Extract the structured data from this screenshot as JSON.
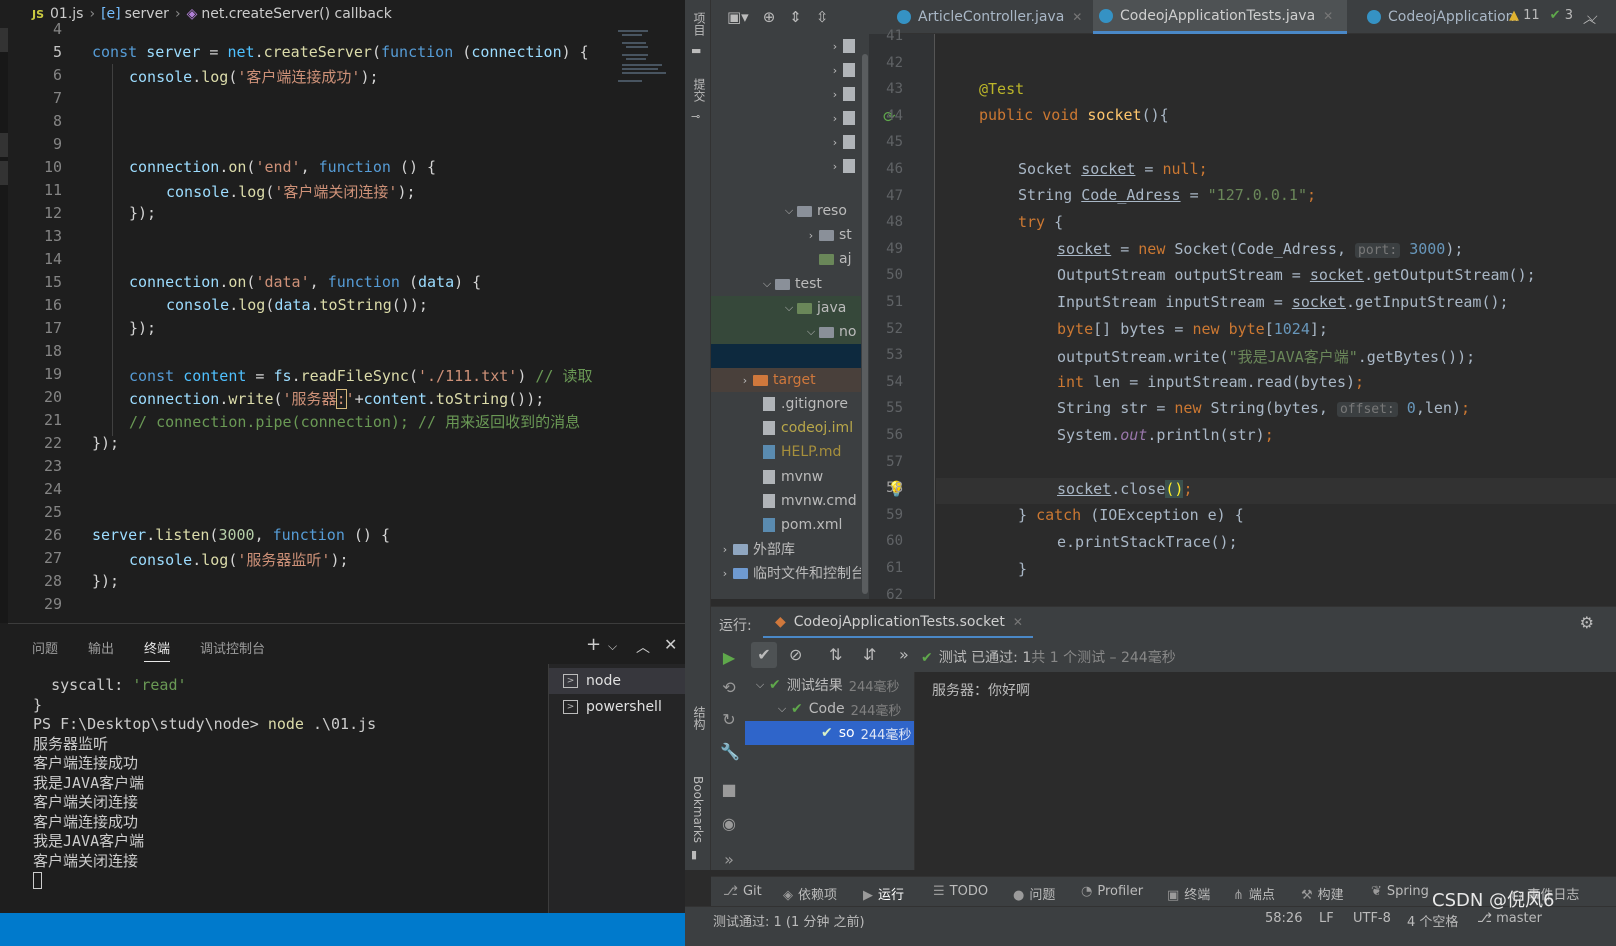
{
  "vscode": {
    "breadcrumb": {
      "lang_badge": "JS",
      "file": "01.js",
      "symbol1": "server",
      "symbol2": "net.createServer() callback"
    },
    "line_numbers": [
      "4",
      "5",
      "6",
      "7",
      "8",
      "9",
      "10",
      "11",
      "12",
      "13",
      "14",
      "15",
      "16",
      "17",
      "18",
      "19",
      "20",
      "21",
      "22",
      "23",
      "24",
      "25",
      "26",
      "27",
      "28",
      "29"
    ],
    "code": {
      "l5": {
        "kw": "const",
        "var": "server",
        "eq": " = ",
        "obj": "net",
        "dot": ".",
        "fn": "createServer",
        "p1": "(",
        "kw2": "function",
        "sp": " (",
        "arg": "connection",
        "rest": ") {"
      },
      "l6": {
        "obj": "console",
        "fn": "log",
        "str": "'客户端连接成功'",
        "end": ");"
      },
      "l10": {
        "obj": "connection",
        "fn": "on",
        "str": "'end'",
        "kw": "function",
        "rest": " () {"
      },
      "l11": {
        "obj": "console",
        "fn": "log",
        "str": "'客户端关闭连接'",
        "end": ");"
      },
      "l12": "});",
      "l15": {
        "obj": "connection",
        "fn": "on",
        "str": "'data'",
        "kw": "function",
        "arg": "data",
        "rest": ") {"
      },
      "l16": {
        "obj": "console",
        "fn": "log",
        "arg": "data",
        "fn2": "toString",
        "end": "());"
      },
      "l17": "});",
      "l19": {
        "kw": "const",
        "var": "content",
        "obj": "fs",
        "fn": "readFileSync",
        "str": "'./111.txt'",
        "cm": "// 读取"
      },
      "l20": {
        "obj": "connection",
        "fn": "write",
        "str_a": "'服务器",
        "str_box": ":",
        "str_b": "'",
        "plus": "+",
        "var": "content",
        "fn2": "toString",
        "end": "());"
      },
      "l21": {
        "cm": "// connection.pipe(connection); // 用来返回收到的消息"
      },
      "l22": "});",
      "l26": {
        "obj": "server",
        "fn": "listen",
        "num": "3000",
        "kw": "function",
        "rest": " () {"
      },
      "l27": {
        "obj": "console",
        "fn": "log",
        "str": "'服务器监听'",
        "end": ");"
      },
      "l28": "});"
    },
    "panel": {
      "tabs": [
        "问题",
        "输出",
        "终端",
        "调试控制台"
      ],
      "active_tab": "终端",
      "terminal": {
        "syscall_key": "syscall: ",
        "syscall_val": "'read'",
        "close_brace": "}",
        "prompt": "PS F:\\Desktop\\study\\node> ",
        "command": "node",
        "command_arg": " .\\01.js",
        "output": [
          "服务器监听",
          "客户端连接成功",
          "我是JAVA客户端",
          "客户端关闭连接",
          "客户端连接成功",
          "我是JAVA客户端",
          "客户端关闭连接"
        ]
      },
      "terminal_list": [
        "node",
        "powershell"
      ]
    }
  },
  "idea": {
    "side_labels": {
      "project": "项目",
      "commit": "提交",
      "structure": "结构",
      "bookmarks": "Bookmarks"
    },
    "tabs": [
      {
        "label": "ArticleController.java"
      },
      {
        "label": "CodeojApplicationTests.java"
      },
      {
        "label": "CodeojApplication."
      }
    ],
    "inspections": {
      "warnings": "11",
      "checks": "3"
    },
    "tree": [
      {
        "label": "reso"
      },
      {
        "label": "st"
      },
      {
        "label": "aj"
      },
      {
        "label": "test"
      },
      {
        "label": "java"
      },
      {
        "label": "no"
      },
      {
        "label": "target"
      },
      {
        "label": ".gitignore"
      },
      {
        "label": "codeoj.iml"
      },
      {
        "label": "HELP.md"
      },
      {
        "label": "mvnw"
      },
      {
        "label": "mvnw.cmd"
      },
      {
        "label": "pom.xml"
      },
      {
        "label": "外部库"
      },
      {
        "label": "临时文件和控制台"
      }
    ],
    "line_numbers": [
      "41",
      "42",
      "43",
      "44",
      "45",
      "46",
      "47",
      "48",
      "49",
      "50",
      "51",
      "52",
      "53",
      "54",
      "55",
      "56",
      "57",
      "58",
      "59",
      "60",
      "61",
      "62"
    ],
    "code": {
      "annot": "@Test",
      "l44": {
        "kw1": "public",
        "kw2": "void",
        "m": "socket",
        "rest": "(){"
      },
      "l46": {
        "t": "Socket ",
        "v": "socket",
        "eq": " = ",
        "kw": "null",
        "end": ";"
      },
      "l47": {
        "t": "String ",
        "v": "Code_Adress",
        "eq": " = ",
        "s": "\"127.0.0.1\"",
        "end": ";"
      },
      "l48": {
        "kw": "try",
        "rest": " {"
      },
      "l49": {
        "v": "socket",
        "eq": " = ",
        "kw": "new",
        "t": " Socket(Code_Adress, ",
        "hint": "port:",
        "n": "3000",
        "end": ");"
      },
      "l50": {
        "t": "OutputStream outputStream = ",
        "v": "socket",
        "rest": ".getOutputStream();"
      },
      "l51": {
        "t": "InputStream inputStream = ",
        "v": "socket",
        "rest": ".getInputStream();"
      },
      "l52": {
        "kw": "byte",
        "t": "[] bytes = ",
        "kw2": "new",
        "kw3": " byte",
        "p": "[",
        "n": "1024",
        "end": "];"
      },
      "l53": {
        "t": "outputStream.write(",
        "s": "\"我是JAVA客户端\"",
        "rest": ".getBytes());"
      },
      "l54": {
        "kw": "int",
        "t": " len = inputStream.read(bytes)",
        "end": ";"
      },
      "l55": {
        "t": "String str = ",
        "kw": "new",
        "t2": " String(bytes, ",
        "hint": "offset:",
        "n": "0",
        "rest": ",len)",
        "end": ";"
      },
      "l56": {
        "t": "System.",
        "f": "out",
        "rest": ".println(str)",
        "end": ";"
      },
      "l58": {
        "v": "socket",
        "rest": ".close",
        "br": "()",
        "end": ";"
      },
      "l59": {
        "p": "} ",
        "kw": "catch",
        "rest": " (IOException e) {"
      },
      "l60": "e.printStackTrace();",
      "l61": "}"
    },
    "run": {
      "label": "运行:",
      "tab": "CodeojApplicationTests.socket",
      "status_main": "测试 已通过: 1",
      "status_dim": "共 1 个测试 – 244毫秒",
      "tree": [
        {
          "label": "测试结果",
          "dur": "244毫秒"
        },
        {
          "label": "Code",
          "dur": "244毫秒"
        },
        {
          "label": "so",
          "dur": "244毫秒"
        }
      ],
      "console": "服务器：你好啊"
    },
    "bottom_tabs": [
      "Git",
      "依赖项",
      "运行",
      "TODO",
      "问题",
      "Profiler",
      "终端",
      "端点",
      "构建",
      "Spring",
      "事件日志"
    ],
    "statusbar": {
      "left": "测试通过: 1 (1 分钟 之前)",
      "pos": "58:26",
      "lf": "LF",
      "enc": "UTF-8",
      "indent": "4 个空格",
      "branch": "master"
    }
  },
  "watermark": "CSDN @倪风6"
}
